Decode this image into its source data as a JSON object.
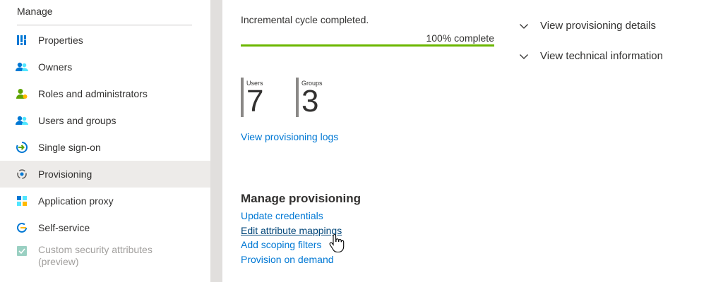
{
  "sidebar": {
    "section_title": "Manage",
    "items": [
      {
        "label": "Properties",
        "icon": "properties-icon",
        "selected": false,
        "disabled": false
      },
      {
        "label": "Owners",
        "icon": "owners-icon",
        "selected": false,
        "disabled": false
      },
      {
        "label": "Roles and administrators",
        "icon": "roles-icon",
        "selected": false,
        "disabled": false
      },
      {
        "label": "Users and groups",
        "icon": "users-groups-icon",
        "selected": false,
        "disabled": false
      },
      {
        "label": "Single sign-on",
        "icon": "sso-icon",
        "selected": false,
        "disabled": false
      },
      {
        "label": "Provisioning",
        "icon": "provisioning-icon",
        "selected": true,
        "disabled": false
      },
      {
        "label": "Application proxy",
        "icon": "app-proxy-icon",
        "selected": false,
        "disabled": false
      },
      {
        "label": "Self-service",
        "icon": "self-service-icon",
        "selected": false,
        "disabled": false
      },
      {
        "label": "Custom security attributes (preview)",
        "icon": "custom-attributes-icon",
        "selected": false,
        "disabled": true
      }
    ]
  },
  "provisioning": {
    "status_text": "Incremental cycle completed.",
    "progress_label": "100% complete",
    "progress_percent": 100,
    "stats": [
      {
        "label": "Users",
        "value": "7"
      },
      {
        "label": "Groups",
        "value": "3"
      }
    ],
    "logs_link": "View provisioning logs",
    "details_toggle": "View provisioning details",
    "technical_toggle": "View technical information"
  },
  "manage_provisioning": {
    "title": "Manage provisioning",
    "links": [
      "Update credentials",
      "Edit attribute mappings",
      "Add scoping filters",
      "Provision on demand"
    ]
  },
  "colors": {
    "link": "#0078d4",
    "progress": "#6bb700",
    "selected_bg": "#edebe9",
    "divider": "#e1dfdd"
  }
}
